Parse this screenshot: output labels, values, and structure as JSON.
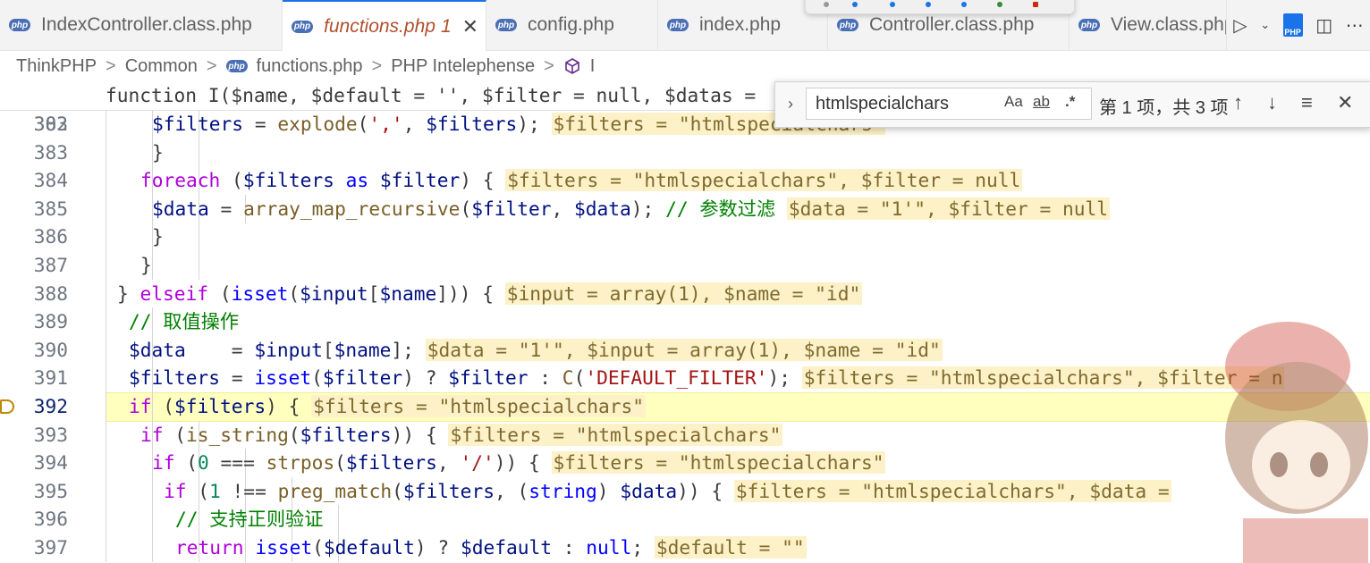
{
  "tabs": [
    {
      "label": "IndexController.class.php",
      "active": false
    },
    {
      "label": "functions.php",
      "active": true,
      "badge": "1"
    },
    {
      "label": "config.php",
      "active": false
    },
    {
      "label": "index.php",
      "active": false
    },
    {
      "label": "Controller.class.php",
      "active": false
    },
    {
      "label": "View.class.php",
      "active": false
    }
  ],
  "php_icon_text": "php",
  "pdf_icon_text": "PHP",
  "breadcrumb": {
    "items": [
      "ThinkPHP",
      "Common",
      "functions.php",
      "PHP Intelephense",
      "I"
    ],
    "separator": ">"
  },
  "find": {
    "query": "htmlspecialchars",
    "match_case": "Aa",
    "whole_word": "ab",
    "regex": ".*",
    "count": "第 1 项，共 3 项"
  },
  "editor": {
    "current_line": "392",
    "sticky": {
      "line": "303",
      "text": "function I($name, $default = '', $filter = null, $datas = "
    },
    "lines": [
      {
        "n": "382",
        "code": "$filters = explode(',', $filters);",
        "inline": "$filters = \"htmlspecialchars\""
      },
      {
        "n": "383",
        "code": "}",
        "inline": ""
      },
      {
        "n": "384",
        "code": "foreach ($filters as $filter) {",
        "inline": "$filters = \"htmlspecialchars\", $filter = null"
      },
      {
        "n": "385",
        "code": "$data = array_map_recursive($filter, $data); // 参数过滤",
        "inline": "$data = \"1'\", $filter = null"
      },
      {
        "n": "386",
        "code": "}",
        "inline": ""
      },
      {
        "n": "387",
        "code": "}",
        "inline": ""
      },
      {
        "n": "388",
        "code": "} elseif (isset($input[$name])) {",
        "inline": "$input = array(1), $name = \"id\""
      },
      {
        "n": "389",
        "code": "// 取值操作",
        "inline": ""
      },
      {
        "n": "390",
        "code": "$data    = $input[$name];",
        "inline": "$data = \"1'\", $input = array(1), $name = \"id\""
      },
      {
        "n": "391",
        "code": "$filters = isset($filter) ? $filter : C('DEFAULT_FILTER');",
        "inline": "$filters = \"htmlspecialchars\", $filter = n"
      },
      {
        "n": "392",
        "code": "if ($filters) {",
        "inline": "$filters = \"htmlspecialchars\""
      },
      {
        "n": "393",
        "code": "if (is_string($filters)) {",
        "inline": "$filters = \"htmlspecialchars\""
      },
      {
        "n": "394",
        "code": "if (0 === strpos($filters, '/')) {",
        "inline": "$filters = \"htmlspecialchars\""
      },
      {
        "n": "395",
        "code": "if (1 !== preg_match($filters, (string) $data)) {",
        "inline": "$filters = \"htmlspecialchars\", $data ="
      },
      {
        "n": "396",
        "code": "// 支持正则验证",
        "inline": ""
      },
      {
        "n": "397",
        "code": "return isset($default) ? $default : null;",
        "inline": "$default = \"\""
      }
    ]
  },
  "colors": {
    "keyword": "#0000ff",
    "control": "#af00db",
    "function": "#795e26",
    "variable": "#001080",
    "string": "#a31515",
    "comment": "#008000",
    "inline_value_bg": "#fdf1c7",
    "current_line_bg": "#ffffbe",
    "active_tab_text": "#b0502d"
  }
}
